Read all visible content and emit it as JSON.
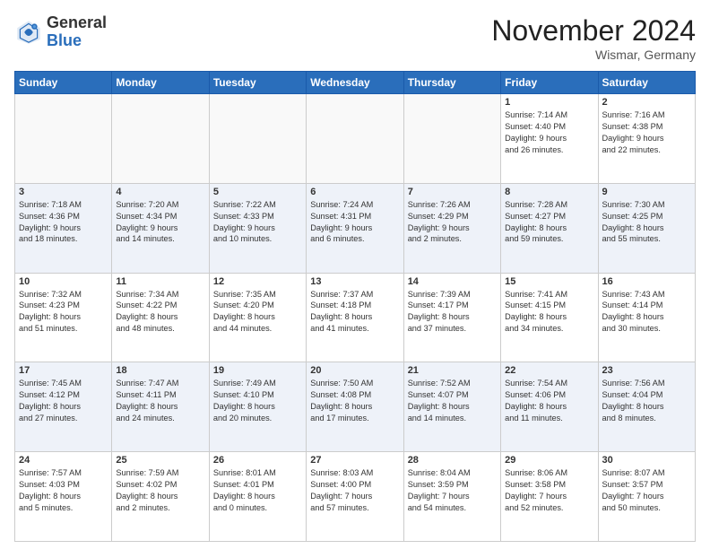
{
  "header": {
    "logo_general": "General",
    "logo_blue": "Blue",
    "month_title": "November 2024",
    "subtitle": "Wismar, Germany"
  },
  "weekdays": [
    "Sunday",
    "Monday",
    "Tuesday",
    "Wednesday",
    "Thursday",
    "Friday",
    "Saturday"
  ],
  "weeks": [
    [
      {
        "day": "",
        "info": ""
      },
      {
        "day": "",
        "info": ""
      },
      {
        "day": "",
        "info": ""
      },
      {
        "day": "",
        "info": ""
      },
      {
        "day": "",
        "info": ""
      },
      {
        "day": "1",
        "info": "Sunrise: 7:14 AM\nSunset: 4:40 PM\nDaylight: 9 hours\nand 26 minutes."
      },
      {
        "day": "2",
        "info": "Sunrise: 7:16 AM\nSunset: 4:38 PM\nDaylight: 9 hours\nand 22 minutes."
      }
    ],
    [
      {
        "day": "3",
        "info": "Sunrise: 7:18 AM\nSunset: 4:36 PM\nDaylight: 9 hours\nand 18 minutes."
      },
      {
        "day": "4",
        "info": "Sunrise: 7:20 AM\nSunset: 4:34 PM\nDaylight: 9 hours\nand 14 minutes."
      },
      {
        "day": "5",
        "info": "Sunrise: 7:22 AM\nSunset: 4:33 PM\nDaylight: 9 hours\nand 10 minutes."
      },
      {
        "day": "6",
        "info": "Sunrise: 7:24 AM\nSunset: 4:31 PM\nDaylight: 9 hours\nand 6 minutes."
      },
      {
        "day": "7",
        "info": "Sunrise: 7:26 AM\nSunset: 4:29 PM\nDaylight: 9 hours\nand 2 minutes."
      },
      {
        "day": "8",
        "info": "Sunrise: 7:28 AM\nSunset: 4:27 PM\nDaylight: 8 hours\nand 59 minutes."
      },
      {
        "day": "9",
        "info": "Sunrise: 7:30 AM\nSunset: 4:25 PM\nDaylight: 8 hours\nand 55 minutes."
      }
    ],
    [
      {
        "day": "10",
        "info": "Sunrise: 7:32 AM\nSunset: 4:23 PM\nDaylight: 8 hours\nand 51 minutes."
      },
      {
        "day": "11",
        "info": "Sunrise: 7:34 AM\nSunset: 4:22 PM\nDaylight: 8 hours\nand 48 minutes."
      },
      {
        "day": "12",
        "info": "Sunrise: 7:35 AM\nSunset: 4:20 PM\nDaylight: 8 hours\nand 44 minutes."
      },
      {
        "day": "13",
        "info": "Sunrise: 7:37 AM\nSunset: 4:18 PM\nDaylight: 8 hours\nand 41 minutes."
      },
      {
        "day": "14",
        "info": "Sunrise: 7:39 AM\nSunset: 4:17 PM\nDaylight: 8 hours\nand 37 minutes."
      },
      {
        "day": "15",
        "info": "Sunrise: 7:41 AM\nSunset: 4:15 PM\nDaylight: 8 hours\nand 34 minutes."
      },
      {
        "day": "16",
        "info": "Sunrise: 7:43 AM\nSunset: 4:14 PM\nDaylight: 8 hours\nand 30 minutes."
      }
    ],
    [
      {
        "day": "17",
        "info": "Sunrise: 7:45 AM\nSunset: 4:12 PM\nDaylight: 8 hours\nand 27 minutes."
      },
      {
        "day": "18",
        "info": "Sunrise: 7:47 AM\nSunset: 4:11 PM\nDaylight: 8 hours\nand 24 minutes."
      },
      {
        "day": "19",
        "info": "Sunrise: 7:49 AM\nSunset: 4:10 PM\nDaylight: 8 hours\nand 20 minutes."
      },
      {
        "day": "20",
        "info": "Sunrise: 7:50 AM\nSunset: 4:08 PM\nDaylight: 8 hours\nand 17 minutes."
      },
      {
        "day": "21",
        "info": "Sunrise: 7:52 AM\nSunset: 4:07 PM\nDaylight: 8 hours\nand 14 minutes."
      },
      {
        "day": "22",
        "info": "Sunrise: 7:54 AM\nSunset: 4:06 PM\nDaylight: 8 hours\nand 11 minutes."
      },
      {
        "day": "23",
        "info": "Sunrise: 7:56 AM\nSunset: 4:04 PM\nDaylight: 8 hours\nand 8 minutes."
      }
    ],
    [
      {
        "day": "24",
        "info": "Sunrise: 7:57 AM\nSunset: 4:03 PM\nDaylight: 8 hours\nand 5 minutes."
      },
      {
        "day": "25",
        "info": "Sunrise: 7:59 AM\nSunset: 4:02 PM\nDaylight: 8 hours\nand 2 minutes."
      },
      {
        "day": "26",
        "info": "Sunrise: 8:01 AM\nSunset: 4:01 PM\nDaylight: 8 hours\nand 0 minutes."
      },
      {
        "day": "27",
        "info": "Sunrise: 8:03 AM\nSunset: 4:00 PM\nDaylight: 7 hours\nand 57 minutes."
      },
      {
        "day": "28",
        "info": "Sunrise: 8:04 AM\nSunset: 3:59 PM\nDaylight: 7 hours\nand 54 minutes."
      },
      {
        "day": "29",
        "info": "Sunrise: 8:06 AM\nSunset: 3:58 PM\nDaylight: 7 hours\nand 52 minutes."
      },
      {
        "day": "30",
        "info": "Sunrise: 8:07 AM\nSunset: 3:57 PM\nDaylight: 7 hours\nand 50 minutes."
      }
    ]
  ]
}
